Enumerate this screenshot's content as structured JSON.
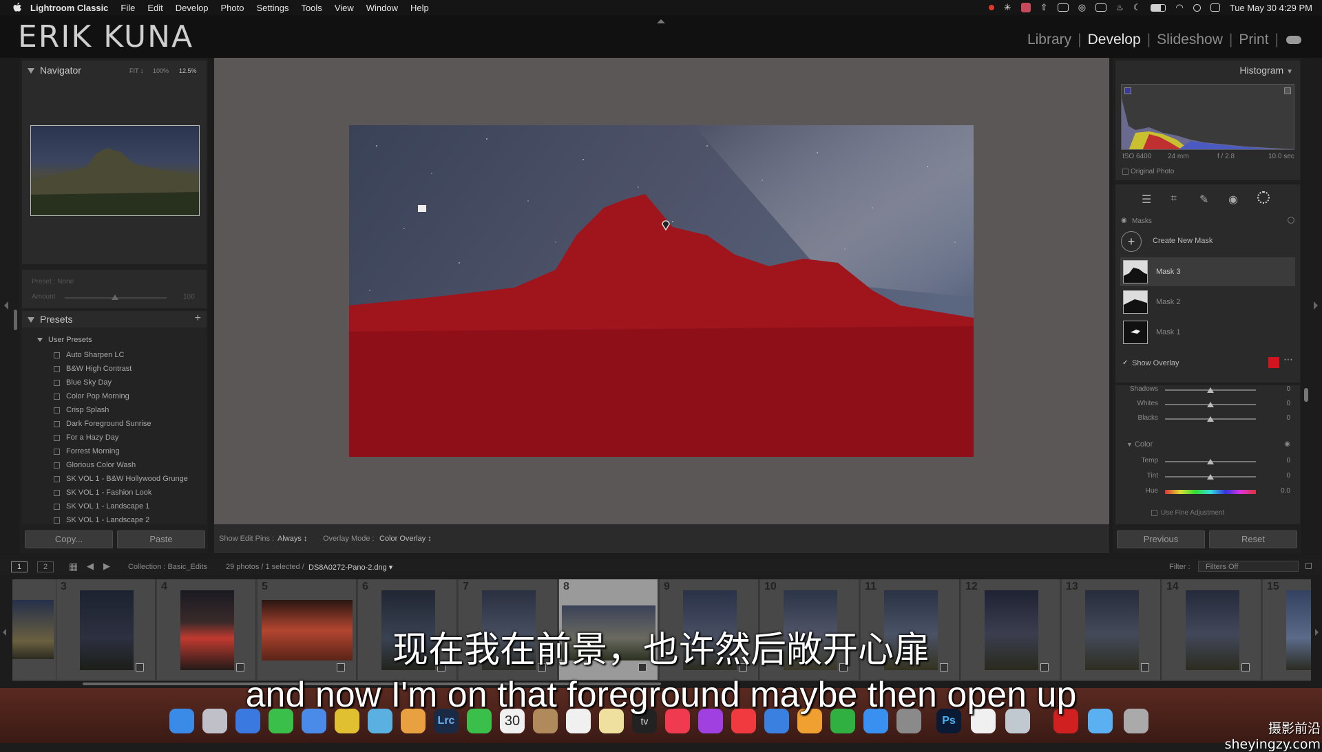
{
  "menubar": {
    "app_name": "Lightroom Classic",
    "items": [
      "File",
      "Edit",
      "Develop",
      "Photo",
      "Settings",
      "Tools",
      "View",
      "Window",
      "Help"
    ],
    "clock": "Tue May 30  4:29 PM"
  },
  "identity_plate": "ERIK KUNA",
  "modules": {
    "items": [
      "Library",
      "Develop",
      "Slideshow",
      "Print"
    ],
    "active": "Develop"
  },
  "navigator": {
    "title": "Navigator",
    "zoom_options": [
      "FIT ↕",
      "100%",
      "12.5%"
    ]
  },
  "preset_amount": {
    "preset_label": "Preset : None",
    "amount_label": "Amount",
    "amount_value": "100"
  },
  "presets": {
    "title": "Presets",
    "group": "User Presets",
    "items": [
      "Auto Sharpen LC",
      "B&W High Contrast",
      "Blue Sky Day",
      "Color Pop Morning",
      "Crisp Splash",
      "Dark Foreground Sunrise",
      "For a Hazy Day",
      "Forrest Morning",
      "Glorious Color Wash",
      "SK VOL 1 - B&W Hollywood Grunge",
      "SK VOL 1 - Fashion Look",
      "SK VOL 1 - Landscape 1",
      "SK VOL 1 - Landscape 2"
    ]
  },
  "left_buttons": {
    "copy": "Copy...",
    "paste": "Paste"
  },
  "toolbar": {
    "show_edit_pins_label": "Show Edit Pins :",
    "show_edit_pins_value": "Always ↕",
    "overlay_mode_label": "Overlay Mode :",
    "overlay_mode_value": "Color Overlay ↕"
  },
  "histogram": {
    "title": "Histogram",
    "iso": "ISO 6400",
    "focal": "24 mm",
    "aperture": "f / 2.8",
    "shutter": "10.0 sec",
    "original_photo_label": "Original Photo"
  },
  "masks": {
    "title": "Masks",
    "create_label": "Create New Mask",
    "items": [
      "Mask 3",
      "Mask 2",
      "Mask 1"
    ],
    "show_overlay_label": "Show Overlay",
    "overlay_color": "#d2141e"
  },
  "adjustments": {
    "rows": [
      {
        "label": "Shadows",
        "value": "0"
      },
      {
        "label": "Whites",
        "value": "0"
      },
      {
        "label": "Blacks",
        "value": "0"
      }
    ],
    "color_section": "Color",
    "color_rows": [
      {
        "label": "Temp",
        "value": "0"
      },
      {
        "label": "Tint",
        "value": "0"
      },
      {
        "label": "Hue",
        "value": "0.0"
      }
    ],
    "fine_adjust_label": "Use Fine Adjustment"
  },
  "right_buttons": {
    "previous": "Previous",
    "reset": "Reset"
  },
  "filmbar": {
    "page1": "1",
    "page2": "2",
    "collection": "Collection : Basic_Edits",
    "count": "29 photos / 1 selected /",
    "filename": "DS8A0272-Pano-2.dng ▾",
    "filter_label": "Filter :",
    "filter_value": "Filters Off"
  },
  "filmstrip": {
    "numbers": [
      "3",
      "4",
      "5",
      "6",
      "7",
      "8",
      "9",
      "10",
      "11",
      "12",
      "13",
      "14",
      "15"
    ],
    "selected": "8"
  },
  "subtitles": {
    "chinese": "现在我在前景，也许然后敞开心扉",
    "english": "and now I'm on that foreground maybe then open up"
  },
  "watermark": "摄影前沿 sheyingzy.com",
  "dock": {
    "lrc_label": "Lrc",
    "calendar_day": "30",
    "ps_label": "Ps",
    "tv_label": "tv"
  }
}
